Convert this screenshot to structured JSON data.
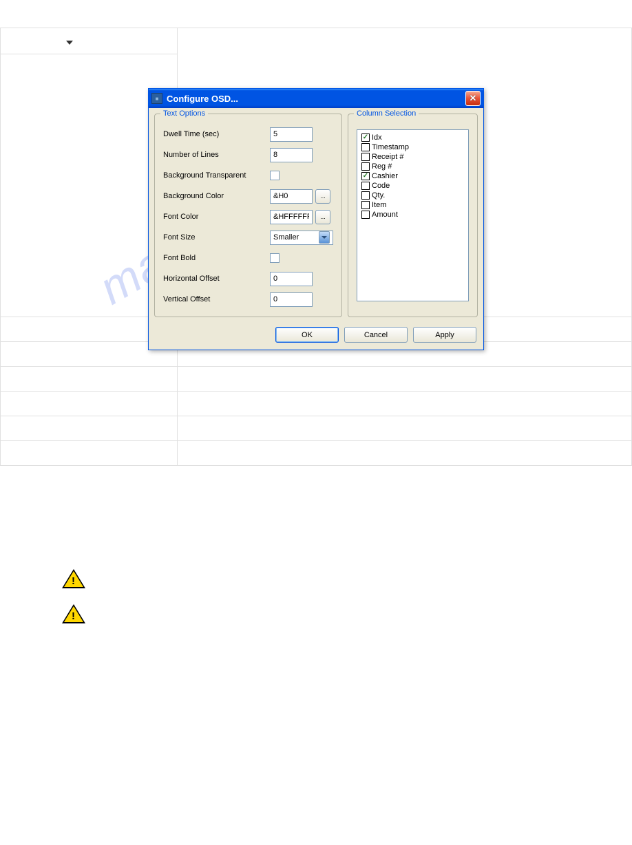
{
  "dialog": {
    "title": "Configure OSD...",
    "text_options": {
      "legend": "Text Options",
      "dwell_time": {
        "label": "Dwell Time (sec)",
        "value": "5"
      },
      "number_of_lines": {
        "label": "Number of Lines",
        "value": "8"
      },
      "bg_transparent": {
        "label": "Background Transparent"
      },
      "bg_color": {
        "label": "Background Color",
        "value": "&H0",
        "picker": "..."
      },
      "font_color": {
        "label": "Font Color",
        "value": "&HFFFFFF",
        "picker": "..."
      },
      "font_size": {
        "label": "Font Size",
        "value": "Smaller"
      },
      "font_bold": {
        "label": "Font Bold"
      },
      "h_offset": {
        "label": "Horizontal Offset",
        "value": "0"
      },
      "v_offset": {
        "label": "Vertical Offset",
        "value": "0"
      }
    },
    "column_selection": {
      "legend": "Column Selection",
      "items": [
        {
          "label": "Idx",
          "checked": true
        },
        {
          "label": "Timestamp",
          "checked": false
        },
        {
          "label": "Receipt #",
          "checked": false
        },
        {
          "label": "Reg #",
          "checked": false
        },
        {
          "label": "Cashier",
          "checked": true
        },
        {
          "label": "Code",
          "checked": false
        },
        {
          "label": "Qty.",
          "checked": false
        },
        {
          "label": "Item",
          "checked": false
        },
        {
          "label": "Amount",
          "checked": false
        }
      ]
    },
    "buttons": {
      "ok": "OK",
      "cancel": "Cancel",
      "apply": "Apply"
    }
  },
  "watermark": "manualshive.com"
}
